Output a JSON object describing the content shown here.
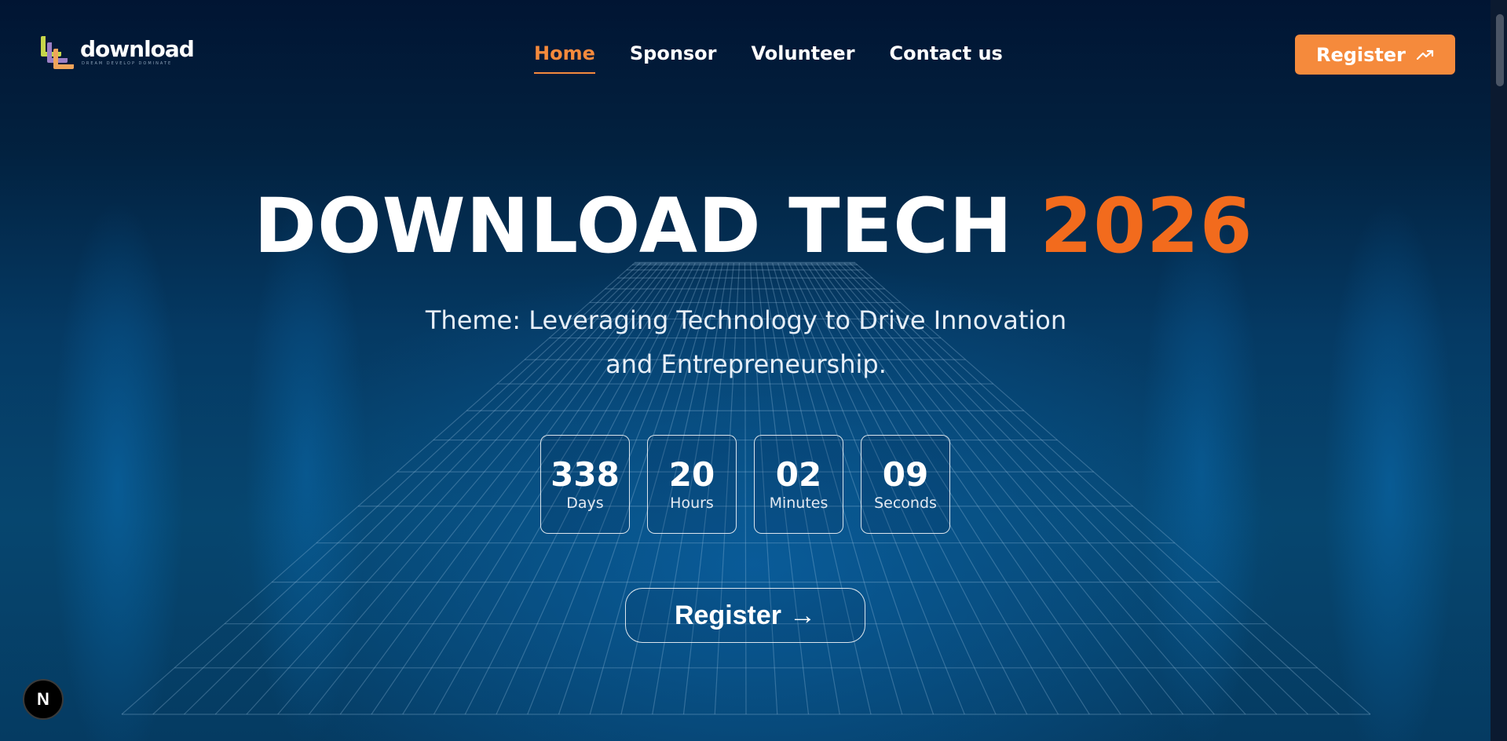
{
  "logo": {
    "word": "download",
    "tagline": "DREAM DEVELOP DOMINATE"
  },
  "nav": {
    "items": [
      "Home",
      "Sponsor",
      "Volunteer",
      "Contact us"
    ],
    "active": "Home"
  },
  "header": {
    "register_label": "Register",
    "register_icon": "trending-up-icon"
  },
  "hero": {
    "title_main": "DOWNLOAD TECH",
    "title_year": "2026",
    "theme": "Theme: Leveraging Technology to Drive Innovation and Entrepreneurship."
  },
  "countdown": [
    {
      "value": "338",
      "label": "Days"
    },
    {
      "value": "20",
      "label": "Hours"
    },
    {
      "value": "02",
      "label": "Minutes"
    },
    {
      "value": "09",
      "label": "Seconds"
    }
  ],
  "cta": {
    "label": "Register",
    "arrow": "→"
  },
  "badge": {
    "letter": "N"
  },
  "colors": {
    "accent": "#f58a3c",
    "year": "#f26b1d",
    "background": "#041530"
  }
}
